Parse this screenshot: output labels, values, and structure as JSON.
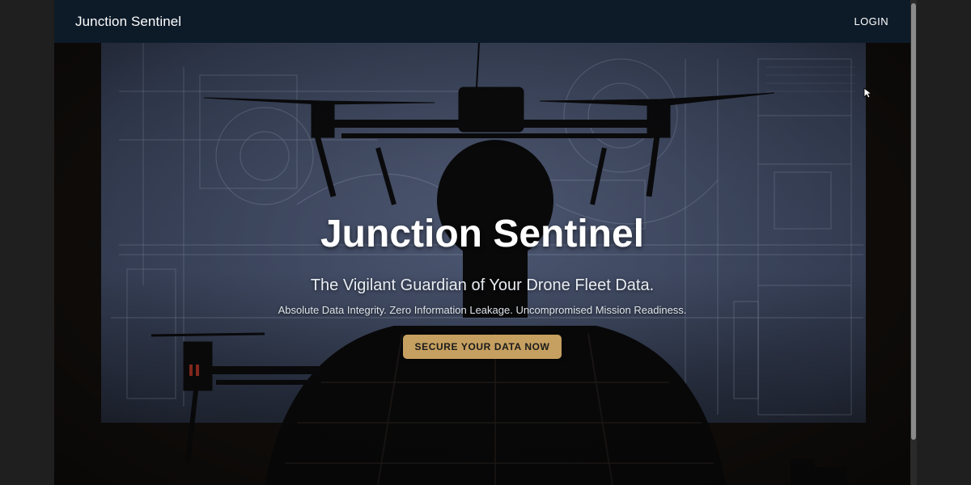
{
  "navbar": {
    "brand": "Junction Sentinel",
    "login_label": "LOGIN"
  },
  "hero": {
    "title": "Junction Sentinel",
    "subtitle": "The Vigilant Guardian of Your Drone Fleet Data.",
    "tagline": "Absolute Data Integrity. Zero Information Leakage. Uncompromised Mission Readiness.",
    "cta_label": "SECURE YOUR DATA NOW"
  },
  "colors": {
    "navbar_bg": "#0d1b29",
    "cta_bg": "#c6a060",
    "page_bg": "#1f1f1f"
  }
}
